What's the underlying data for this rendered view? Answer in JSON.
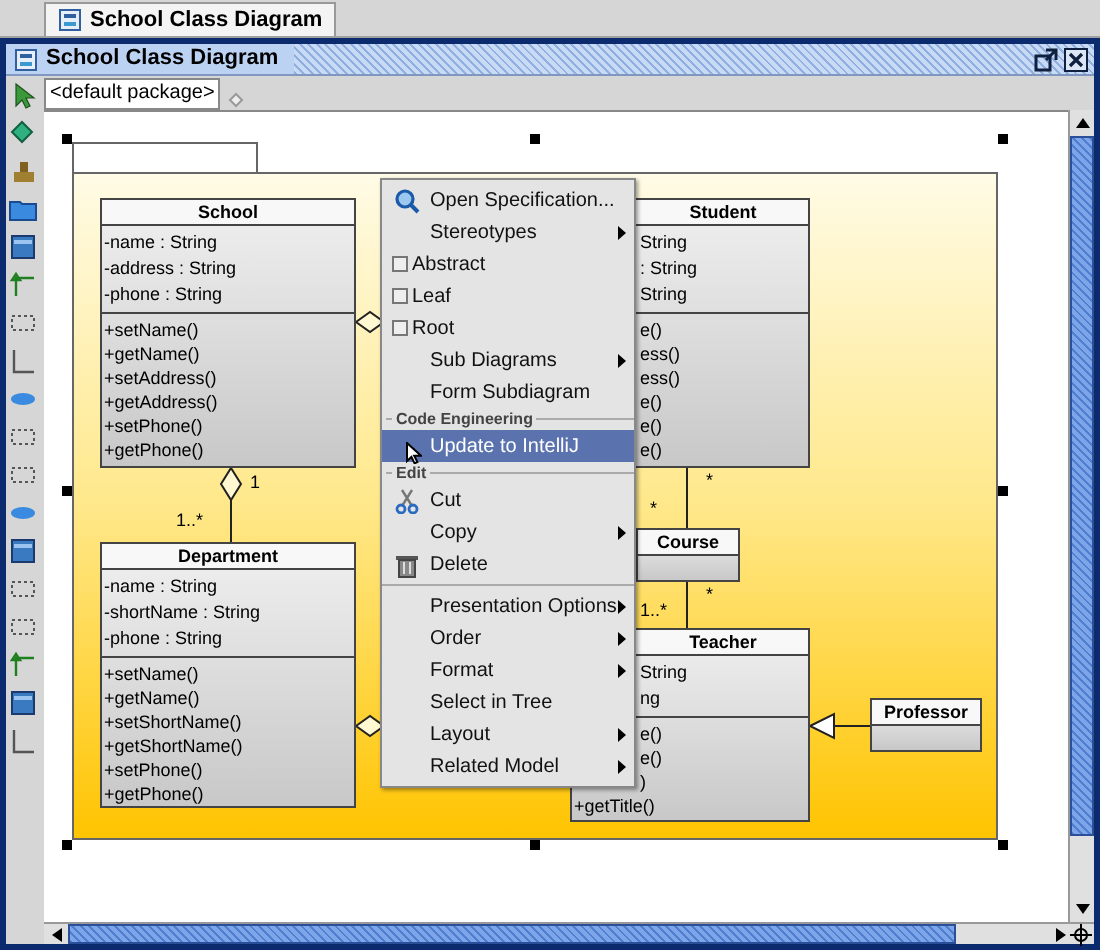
{
  "document_tabs": [
    {
      "label": "School Class Diagram",
      "selected": true
    }
  ],
  "window": {
    "title": "School Class Diagram"
  },
  "package_selector": {
    "value": "<default package>"
  },
  "classes": [
    {
      "name": "School",
      "attributes": [
        "-name : String",
        "-address : String",
        "-phone : String"
      ],
      "operations": [
        "+setName()",
        "+getName()",
        "+setAddress()",
        "+getAddress()",
        "+setPhone()",
        "+getPhone()"
      ]
    },
    {
      "name": "Department",
      "attributes": [
        "-name : String",
        "-shortName : String",
        "-phone : String"
      ],
      "operations": [
        "+setName()",
        "+getName()",
        "+setShortName()",
        "+getShortName()",
        "+setPhone()",
        "+getPhone()"
      ]
    },
    {
      "name": "Student",
      "attributes": [
        "String",
        ": String",
        "String"
      ],
      "operations": [
        "e()",
        "ess()",
        "ess()",
        "e()",
        "e()",
        "e()"
      ]
    },
    {
      "name": "Course"
    },
    {
      "name": "Teacher",
      "attributes": [
        "String",
        "ng"
      ],
      "operations": [
        "e()",
        "e()",
        ")",
        "+getTitle()"
      ]
    },
    {
      "name": "Professor"
    }
  ],
  "multiplicities": [
    "1",
    "1..*",
    "*",
    "*",
    "*",
    "1..*"
  ],
  "context_menu": {
    "items": [
      {
        "kind": "item",
        "label": "Open Specification...",
        "submenu": false,
        "selected": false
      },
      {
        "kind": "item",
        "label": "Stereotypes",
        "submenu": true,
        "selected": false
      },
      {
        "kind": "checkbox",
        "label": "Abstract",
        "checked": false,
        "selected": false
      },
      {
        "kind": "checkbox",
        "label": "Leaf",
        "checked": false,
        "selected": false
      },
      {
        "kind": "checkbox",
        "label": "Root",
        "checked": false,
        "selected": false
      },
      {
        "kind": "item",
        "label": "Sub Diagrams",
        "submenu": true,
        "selected": false
      },
      {
        "kind": "item",
        "label": "Form Subdiagram",
        "submenu": false,
        "selected": false
      },
      {
        "kind": "section",
        "label": "Code Engineering"
      },
      {
        "kind": "item",
        "label": "Update to IntelliJ",
        "submenu": false,
        "selected": true
      },
      {
        "kind": "section",
        "label": "Edit"
      },
      {
        "kind": "item",
        "label": "Cut",
        "submenu": false,
        "selected": false
      },
      {
        "kind": "item",
        "label": "Copy",
        "submenu": true,
        "selected": false
      },
      {
        "kind": "item",
        "label": "Delete",
        "submenu": false,
        "selected": false
      },
      {
        "kind": "separator"
      },
      {
        "kind": "item",
        "label": "Presentation Options",
        "submenu": true,
        "selected": false
      },
      {
        "kind": "item",
        "label": "Order",
        "submenu": true,
        "selected": false
      },
      {
        "kind": "item",
        "label": "Format",
        "submenu": true,
        "selected": false
      },
      {
        "kind": "item",
        "label": "Select in Tree",
        "submenu": false,
        "selected": false
      },
      {
        "kind": "item",
        "label": "Layout",
        "submenu": true,
        "selected": false
      },
      {
        "kind": "item",
        "label": "Related Model",
        "submenu": true,
        "selected": false
      }
    ]
  }
}
